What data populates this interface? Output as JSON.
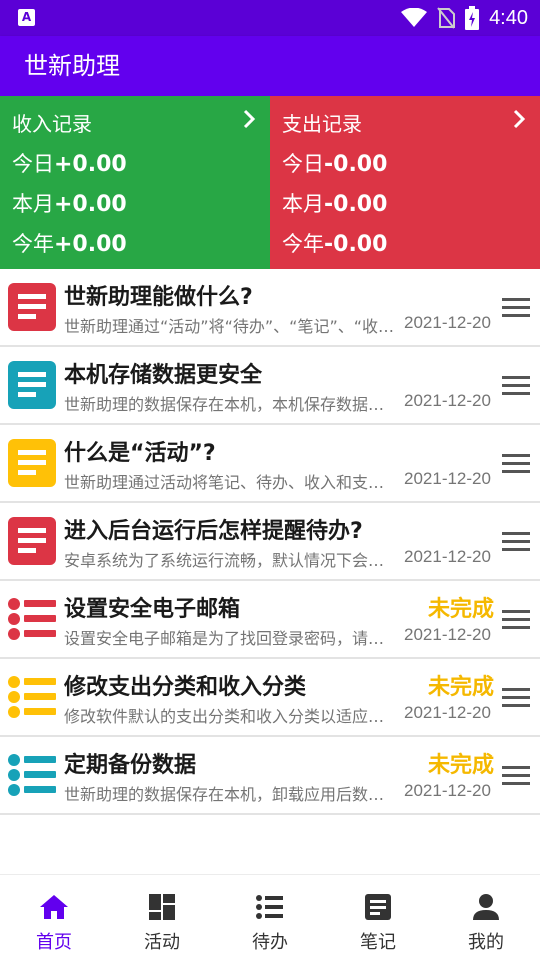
{
  "status_bar": {
    "time": "4:40"
  },
  "app_bar": {
    "title": "世新助理"
  },
  "income": {
    "header": "收入记录",
    "today_label": "今日",
    "today_value": "+0.00",
    "month_label": "本月",
    "month_value": "+0.00",
    "year_label": "今年",
    "year_value": "+0.00"
  },
  "expense": {
    "header": "支出记录",
    "today_label": "今日",
    "today_value": "-0.00",
    "month_label": "本月",
    "month_value": "-0.00",
    "year_label": "今年",
    "year_value": "-0.00"
  },
  "items": [
    {
      "title": "世新助理能做什么?",
      "desc": "世新助理通过“活动”将“待办”、“笔记”、“收入”和“支出”关联起来",
      "date": "2021-12-20",
      "status": "",
      "icon": "note-icon",
      "color": "#dc3545"
    },
    {
      "title": "本机存储数据更安全",
      "desc": "世新助理的数据保存在本机，本机保存数据更安全可靠",
      "date": "2021-12-20",
      "status": "",
      "icon": "note-icon",
      "color": "#17a2b8"
    },
    {
      "title": "什么是“活动”?",
      "desc": "世新助理通过活动将笔记、待办、收入和支出联系在一起",
      "date": "2021-12-20",
      "status": "",
      "icon": "note-icon",
      "color": "#ffc107"
    },
    {
      "title": "进入后台运行后怎样提醒待办?",
      "desc": "安卓系统为了系统运行流畅，默认情况下会限制应用后台运行",
      "date": "2021-12-20",
      "status": "",
      "icon": "note-icon",
      "color": "#dc3545"
    },
    {
      "title": "设置安全电子邮箱",
      "desc": "设置安全电子邮箱是为了找回登录密码，请尽快设置",
      "date": "2021-12-20",
      "status": "未完成",
      "icon": "todo-list-icon",
      "color": "#dc3545"
    },
    {
      "title": "修改支出分类和收入分类",
      "desc": "修改软件默认的支出分类和收入分类以适应自己的需要",
      "date": "2021-12-20",
      "status": "未完成",
      "icon": "todo-list-icon",
      "color": "#ffc107"
    },
    {
      "title": "定期备份数据",
      "desc": "世新助理的数据保存在本机，卸载应用后数据将丢失",
      "date": "2021-12-20",
      "status": "未完成",
      "icon": "todo-list-icon",
      "color": "#17a2b8"
    }
  ],
  "tabs": [
    {
      "label": "首页",
      "icon": "home-icon",
      "active": true
    },
    {
      "label": "活动",
      "icon": "dashboard-icon",
      "active": false
    },
    {
      "label": "待办",
      "icon": "list-icon",
      "active": false
    },
    {
      "label": "笔记",
      "icon": "notebook-icon",
      "active": false
    },
    {
      "label": "我的",
      "icon": "person-icon",
      "active": false
    }
  ],
  "colors": {
    "primary": "#6200ee",
    "status_bar": "#5b00d6",
    "income": "#28a745",
    "expense": "#dc3545",
    "pending": "#f5b800"
  }
}
